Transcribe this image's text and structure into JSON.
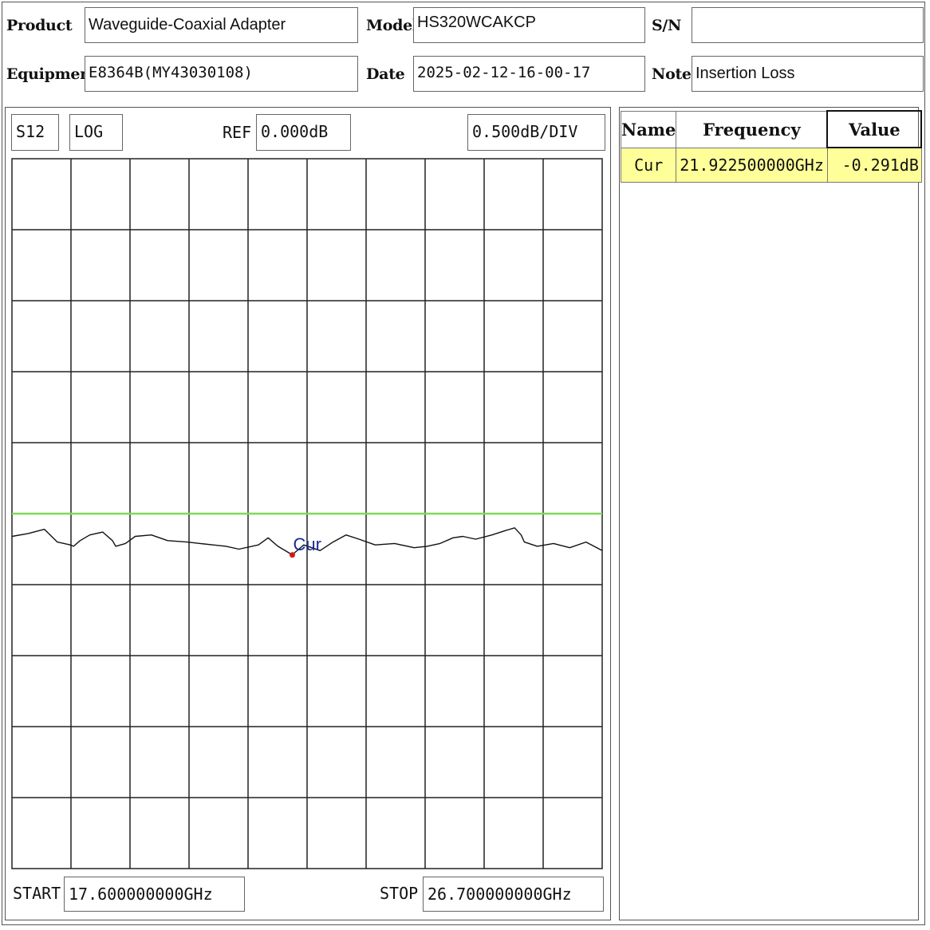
{
  "header": {
    "product_label": "Product",
    "product_value": "Waveguide-Coaxial Adapter",
    "model_label": "Model",
    "model_value": "HS320WCAKCP",
    "sn_label": "S/N",
    "sn_value": "",
    "equipment_label": "Equipment",
    "equipment_value": "E8364B(MY43030108)",
    "date_label": "Date",
    "date_value": "2025-02-12-16-00-17",
    "note_label": "Note",
    "note_value": "Insertion Loss"
  },
  "controls": {
    "param": "S12",
    "format": "LOG",
    "ref_label": "REF",
    "ref_value": "0.000dB",
    "scale": "0.500dB/DIV",
    "start_label": "START",
    "start_value": "17.600000000GHz",
    "stop_label": "STOP",
    "stop_value": "26.700000000GHz"
  },
  "marker_table": {
    "headers": {
      "name": "Name",
      "frequency": "Frequency",
      "value": "Value"
    },
    "rows": [
      {
        "name": "Cur",
        "frequency": "21.922500000GHz",
        "value": "-0.291dB"
      }
    ]
  },
  "colors": {
    "trace": "#111111",
    "reference_line": "#7ed957",
    "marker": "#d11a1a",
    "marker_label": "#1a2a9a",
    "highlight": "#ffff99"
  },
  "chart_data": {
    "type": "line",
    "title": "",
    "xlabel": "",
    "ylabel": "",
    "xlim": [
      17.6,
      26.7
    ],
    "ylim": [
      -2.5,
      2.5
    ],
    "x_divisions": 10,
    "y_divisions": 10,
    "grid": true,
    "x_unit": "GHz",
    "y_unit": "dB",
    "reference_line": {
      "y": 0.0
    },
    "series": [
      {
        "x": [
          17.6,
          17.85,
          18.1,
          18.3,
          18.5,
          18.55,
          18.65,
          18.8,
          19.0,
          19.15,
          19.2,
          19.35,
          19.5,
          19.75,
          20.0,
          20.3,
          20.5,
          20.7,
          20.9,
          21.1,
          21.4,
          21.55,
          21.7,
          21.85,
          21.92,
          22.1,
          22.35,
          22.55,
          22.75,
          22.95,
          23.2,
          23.5,
          23.8,
          24.0,
          24.2,
          24.4,
          24.55,
          24.75,
          25.0,
          25.2,
          25.35,
          25.45,
          25.5,
          25.7,
          25.95,
          26.2,
          26.45,
          26.7
        ],
        "y": [
          -0.16,
          -0.14,
          -0.11,
          -0.2,
          -0.22,
          -0.23,
          -0.19,
          -0.15,
          -0.13,
          -0.19,
          -0.23,
          -0.21,
          -0.16,
          -0.15,
          -0.19,
          -0.2,
          -0.21,
          -0.22,
          -0.23,
          -0.25,
          -0.22,
          -0.17,
          -0.23,
          -0.27,
          -0.29,
          -0.22,
          -0.26,
          -0.2,
          -0.15,
          -0.18,
          -0.22,
          -0.21,
          -0.24,
          -0.23,
          -0.21,
          -0.17,
          -0.16,
          -0.18,
          -0.15,
          -0.12,
          -0.1,
          -0.15,
          -0.2,
          -0.23,
          -0.21,
          -0.24,
          -0.2,
          -0.26
        ]
      }
    ],
    "markers": [
      {
        "name": "Cur",
        "x": 21.9225,
        "y": -0.291
      }
    ]
  }
}
